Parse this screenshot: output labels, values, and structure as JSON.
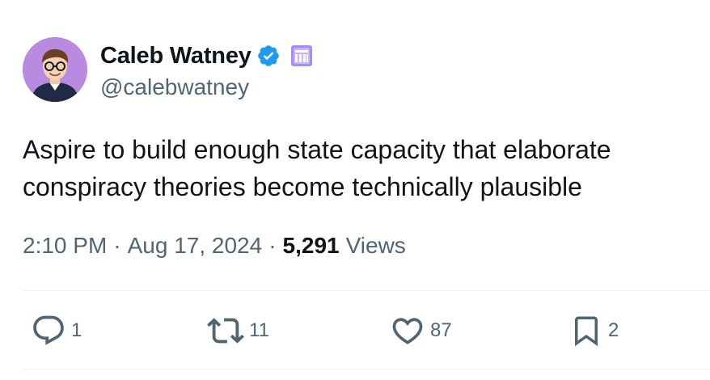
{
  "author": {
    "display_name": "Caleb Watney",
    "handle": "@calebwatney",
    "verified_color": "#1d9bf0",
    "affiliation_badge_color": "#a78bfa",
    "avatar_bg": "#b88be0"
  },
  "tweet": {
    "text": "Aspire to build enough state capacity that elaborate conspiracy theories become technically plausible"
  },
  "meta": {
    "time": "2:10 PM",
    "separator": "·",
    "date": "Aug 17, 2024",
    "views_count": "5,291",
    "views_label": "Views"
  },
  "actions": {
    "replies": "1",
    "reposts": "11",
    "likes": "87",
    "bookmarks": "2"
  },
  "icons": {
    "reply": "reply-icon",
    "repost": "repost-icon",
    "like": "heart-icon",
    "bookmark": "bookmark-icon",
    "verified": "verified-badge-icon",
    "affiliation": "affiliation-badge-icon"
  }
}
